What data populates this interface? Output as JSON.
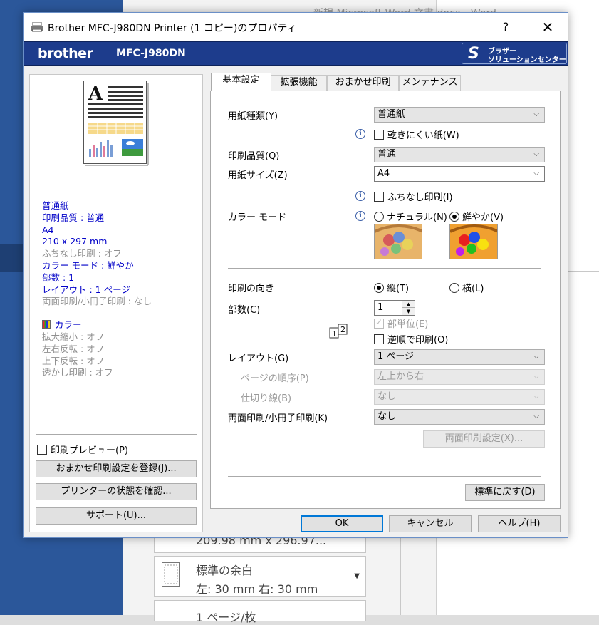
{
  "background": {
    "doc_title": "新規 Microsoft Word 文書.docx  -  Word",
    "items": [
      {
        "line1": "",
        "line2": "209.98 mm x 296.97..."
      },
      {
        "line1": "標準の余白",
        "line2": "左:  30 mm      右:  30 mm"
      },
      {
        "line1": "1 ページ/枚",
        "line2": ""
      }
    ]
  },
  "dialog": {
    "title": "Brother MFC-J980DN Printer (1 コピー)のプロパティ",
    "help_button": "?",
    "close_button": "✕",
    "brand": "brother",
    "model": "MFC-J980DN",
    "solutions_center": {
      "line1": "ブラザー",
      "line2": "ソリューションセンター"
    }
  },
  "summary": {
    "paper_type": "普通紙",
    "quality": "印刷品質 : 普通",
    "size": "A4",
    "dimensions": "210 x 297 mm",
    "borderless": "ふちなし印刷 : オフ",
    "color_mode": "カラー モード : 鮮やか",
    "copies": "部数 : 1",
    "layout": "レイアウト : 1 ページ",
    "duplex": "両面印刷/小冊子印刷 : なし",
    "color": "カラー",
    "scaling": "拡大縮小 : オフ",
    "mirror": "左右反転 : オフ",
    "reverse": "上下反転 : オフ",
    "watermark": "透かし印刷 : オフ"
  },
  "left": {
    "print_preview": "印刷プレビュー(P)",
    "register_button": "おまかせ印刷設定を登録(J)...",
    "status_button": "プリンターの状態を確認...",
    "support_button": "サポート(U)..."
  },
  "tabs": [
    "基本設定",
    "拡張機能",
    "おまかせ印刷",
    "メンテナンス"
  ],
  "basic": {
    "media_type_label": "用紙種類(Y)",
    "media_type_value": "普通紙",
    "slow_drying": "乾きにくい紙(W)",
    "quality_label": "印刷品質(Q)",
    "quality_value": "普通",
    "paper_size_label": "用紙サイズ(Z)",
    "paper_size_value": "A4",
    "borderless": "ふちなし印刷(I)",
    "color_mode_label": "カラー モード",
    "natural": "ナチュラル(N)",
    "vivid": "鮮やか(V)",
    "orientation_label": "印刷の向き",
    "portrait": "縦(T)",
    "landscape": "横(L)",
    "copies_label": "部数(C)",
    "copies_value": "1",
    "collate": "部単位(E)",
    "reverse_order": "逆順で印刷(O)",
    "layout_label": "レイアウト(G)",
    "layout_value": "1 ページ",
    "page_order_label": "ページの順序(P)",
    "page_order_value": "左上から右",
    "border_line_label": "仕切り線(B)",
    "border_line_value": "なし",
    "duplex_label": "両面印刷/小冊子印刷(K)",
    "duplex_value": "なし",
    "duplex_settings": "両面印刷設定(X)...",
    "default_button": "標準に戻す(D)"
  },
  "footer": {
    "ok": "OK",
    "cancel": "キャンセル",
    "help": "ヘルプ(H)"
  },
  "icon_glyphs": {
    "info": "i",
    "chevron": "⌵",
    "spin_up": "▲",
    "spin_down": "▼"
  }
}
